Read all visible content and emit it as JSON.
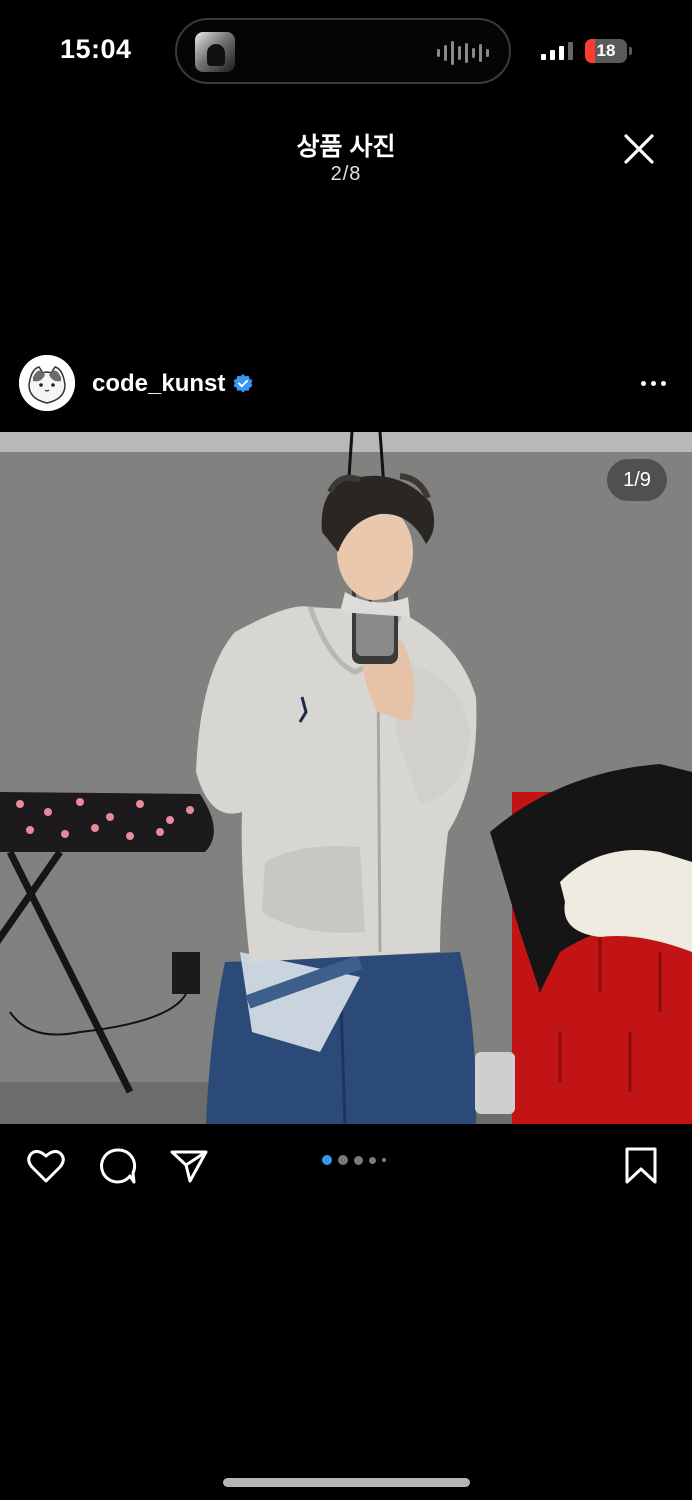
{
  "status_bar": {
    "time": "15:04",
    "battery": "18"
  },
  "header": {
    "title": "상품 사진",
    "counter": "2/8"
  },
  "post": {
    "username": "code_kunst",
    "verified": true,
    "photo_counter": "1/9"
  },
  "icons": {
    "close": "close-icon",
    "more": "more-options-icon",
    "like": "heart-icon",
    "comment": "comment-icon",
    "share": "send-icon",
    "save": "bookmark-icon",
    "verified": "verified-badge-icon"
  },
  "carousel": {
    "total_dots": 5,
    "active_index": 0
  },
  "colors": {
    "accent": "#3897f0",
    "battery_low": "#ff3b30"
  }
}
